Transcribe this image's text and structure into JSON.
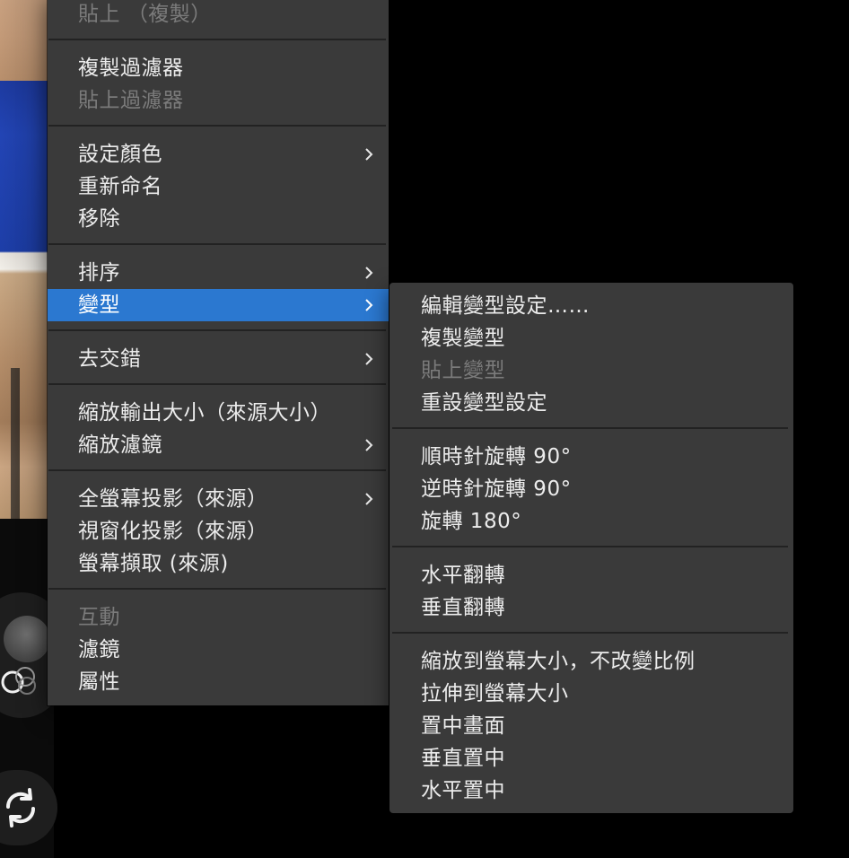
{
  "main_menu": {
    "items": [
      {
        "label": "貼上 （複製）",
        "enabled": false
      },
      {
        "label": "複製過濾器",
        "enabled": true
      },
      {
        "label": "貼上過濾器",
        "enabled": false
      },
      {
        "label": "設定顏色",
        "enabled": true,
        "submenu": true
      },
      {
        "label": "重新命名",
        "enabled": true
      },
      {
        "label": "移除",
        "enabled": true
      },
      {
        "label": "排序",
        "enabled": true,
        "submenu": true
      },
      {
        "label": "變型",
        "enabled": true,
        "submenu": true,
        "selected": true
      },
      {
        "label": "去交錯",
        "enabled": true,
        "submenu": true
      },
      {
        "label": "縮放輸出大小（來源大小）",
        "enabled": true
      },
      {
        "label": "縮放濾鏡",
        "enabled": true,
        "submenu": true
      },
      {
        "label": "全螢幕投影（來源）",
        "enabled": true,
        "submenu": true
      },
      {
        "label": "視窗化投影（來源）",
        "enabled": true
      },
      {
        "label": "螢幕擷取 (來源)",
        "enabled": true
      },
      {
        "label": "互動",
        "enabled": false
      },
      {
        "label": "濾鏡",
        "enabled": true
      },
      {
        "label": "屬性",
        "enabled": true
      }
    ]
  },
  "transform_submenu": {
    "items": [
      {
        "label": "編輯變型設定……",
        "enabled": true
      },
      {
        "label": "複製變型",
        "enabled": true
      },
      {
        "label": "貼上變型",
        "enabled": false
      },
      {
        "label": "重設變型設定",
        "enabled": true
      },
      {
        "label": "順時針旋轉 90°",
        "enabled": true
      },
      {
        "label": "逆時針旋轉 90°",
        "enabled": true
      },
      {
        "label": "旋轉 180°",
        "enabled": true
      },
      {
        "label": "水平翻轉",
        "enabled": true
      },
      {
        "label": "垂直翻轉",
        "enabled": true
      },
      {
        "label": "縮放到螢幕大小，不改變比例",
        "enabled": true
      },
      {
        "label": "拉伸到螢幕大小",
        "enabled": true
      },
      {
        "label": "置中畫面",
        "enabled": true
      },
      {
        "label": "垂直置中",
        "enabled": true
      },
      {
        "label": "水平置中",
        "enabled": true
      }
    ]
  },
  "colors": {
    "menu_bg": "#3a3a3a",
    "highlight": "#2b78d0",
    "text": "#ececec",
    "disabled_text": "#7b7b7b"
  },
  "icons": {
    "submenu_arrow": "chevron-right-icon",
    "audio_mixer": "circles-icon",
    "refresh": "rotate-icon"
  }
}
